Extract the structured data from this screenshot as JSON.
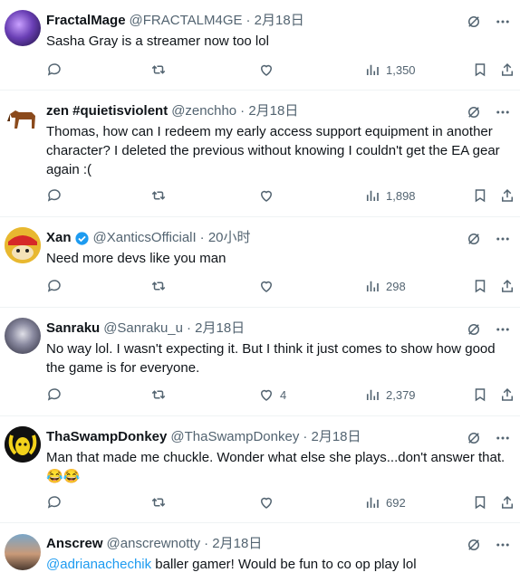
{
  "tweets": [
    {
      "name": "FractalMage",
      "handle": "@FRACTALM4GE",
      "time": "· 2月18日",
      "text": "Sasha Gray is a streamer now too lol",
      "views": "1,350",
      "likes": ""
    },
    {
      "name": "zen #quietisviolent",
      "handle": "@zenchho",
      "time": "· 2月18日",
      "text": "Thomas, how can I redeem my early access support equipment in another character? I deleted the previous without knowing I couldn't get the EA gear again :(",
      "views": "1,898",
      "likes": ""
    },
    {
      "name": "Xan",
      "handle": "@XanticsOfficialI",
      "time": "· 20小时",
      "text": "Need more devs like you man",
      "views": "298",
      "likes": ""
    },
    {
      "name": "Sanraku",
      "handle": "@Sanraku_u",
      "time": "· 2月18日",
      "text": "No way lol. I wasn't expecting it. But I think it just comes to show how good the game is for everyone.",
      "views": "2,379",
      "likes": "4"
    },
    {
      "name": "ThaSwampDonkey",
      "handle": "@ThaSwampDonkey",
      "time": "· 2月18日",
      "text": "Man that made me chuckle. Wonder what else she plays...don't answer that. 😂😂",
      "views": "692",
      "likes": ""
    },
    {
      "name": "Anscrew",
      "handle": "@anscrewnotty",
      "time": "· 2月18日",
      "mention": "@adrianachechik",
      "text": " baller gamer! Would be fun to co op play lol"
    }
  ],
  "colors": {
    "accent": "#1d9bf0",
    "secondary_text": "#536471",
    "border": "#eff3f4"
  }
}
